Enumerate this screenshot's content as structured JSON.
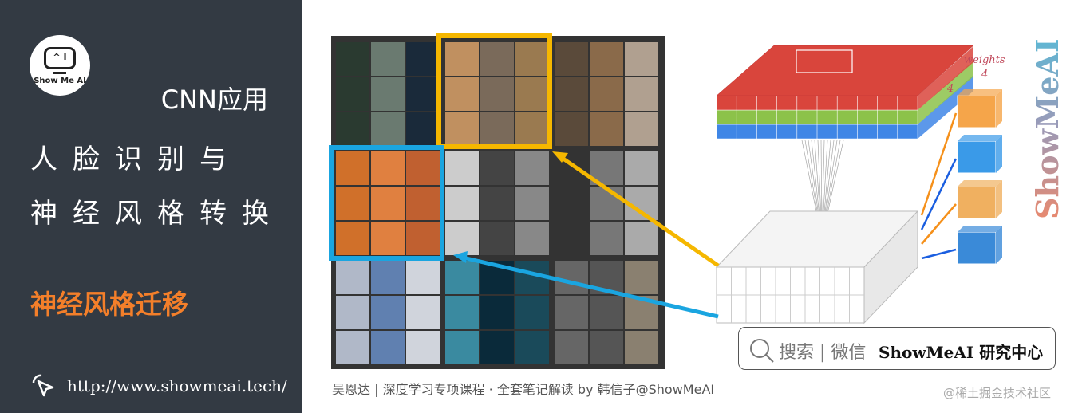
{
  "sidebar": {
    "logo_text": "Show Me AI",
    "logo_face": "^ I",
    "title_line1": "CNN应用",
    "title_line2": "人脸识别与",
    "title_line3": "神经风格转换",
    "subtitle": "神经风格迁移",
    "url": "http://www.showmeai.tech/",
    "url_icon": "cursor-click-icon"
  },
  "figure": {
    "weights_label": "weights",
    "dim_a": "4",
    "dim_b": "4",
    "highlight_colors": {
      "yellow": "#f5b700",
      "blue": "#1aa5e0"
    },
    "layer_colors": [
      "#d9453c",
      "#8cc24a",
      "#3f86e6"
    ],
    "brand_watermark": "ShowMeAI"
  },
  "search_box": {
    "icon": "search-icon",
    "label": "搜索 | 微信",
    "brand": "ShowMeAI 研究中心"
  },
  "caption": "吴恩达 | 深度学习专项课程 · 全套笔记解读  by 韩信子@ShowMeAI",
  "watermark": "@稀土掘金技术社区"
}
